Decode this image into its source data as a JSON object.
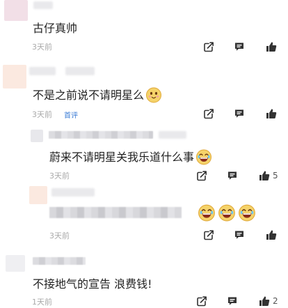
{
  "comments": [
    {
      "text": "古仔真帅",
      "time": "3天前"
    },
    {
      "text": "不是之前说不请明星么",
      "time": "3天前",
      "tag": "首评"
    },
    {
      "text": "蔚来不请明星关我乐道什么事",
      "time": "3天前",
      "likes": "5"
    },
    {
      "text": "",
      "time": "3天前"
    },
    {
      "text": "不接地气的宣告 浪费钱!",
      "time": "1天前",
      "likes": "2"
    }
  ],
  "icons": {
    "share": "share-icon",
    "reply": "comment-icon",
    "like": "thumbs-up-icon",
    "emoji": "laughing-emoji-icon"
  },
  "colors": {
    "icon": "#333333",
    "meta": "#a9a9a9",
    "tag": "#3a7bd5"
  }
}
